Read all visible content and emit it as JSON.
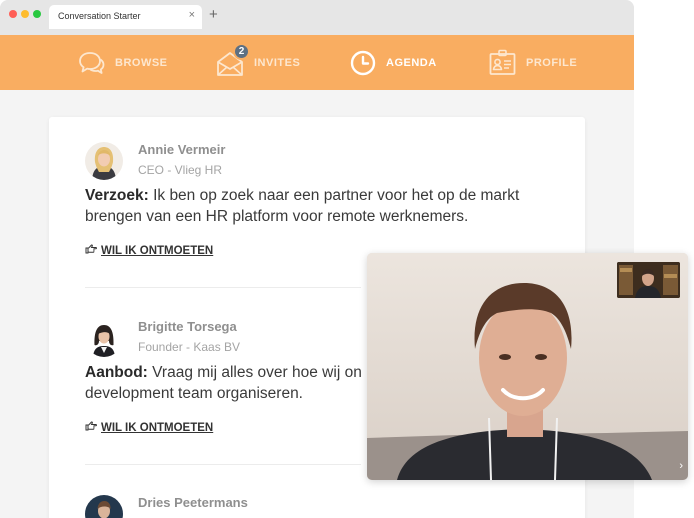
{
  "browser": {
    "tab_title": "Conversation Starter",
    "tab_close": "×",
    "new_tab": "+"
  },
  "nav": {
    "items": [
      {
        "label": "BROWSE",
        "icon": "chat-bubbles-icon"
      },
      {
        "label": "INVITES",
        "icon": "envelope-icon",
        "badge": "2"
      },
      {
        "label": "AGENDA",
        "icon": "clock-icon",
        "active": true
      },
      {
        "label": "PROFILE",
        "icon": "id-card-icon"
      }
    ]
  },
  "feed": {
    "entries": [
      {
        "name": "Annie Vermeir",
        "role": "CEO - Vlieg HR",
        "kind": "Verzoek:",
        "text": "Ik ben op zoek naar een partner voor het op de markt brengen van een HR platform voor remote werknemers.",
        "link": "WIL IK ONTMOETEN"
      },
      {
        "name": "Brigitte Torsega",
        "role": "Founder - Kaas BV",
        "kind": "Aanbod:",
        "text": "Vraag mij alles over hoe wij on",
        "text2": "development team organiseren.",
        "link": "WIL IK ONTMOETEN"
      },
      {
        "name": "Dries Peetermans"
      }
    ]
  },
  "video": {
    "next": "›"
  },
  "colors": {
    "nav_background": "#f9ad61",
    "badge": "#5e7083",
    "page_background": "#f4f4f4"
  }
}
